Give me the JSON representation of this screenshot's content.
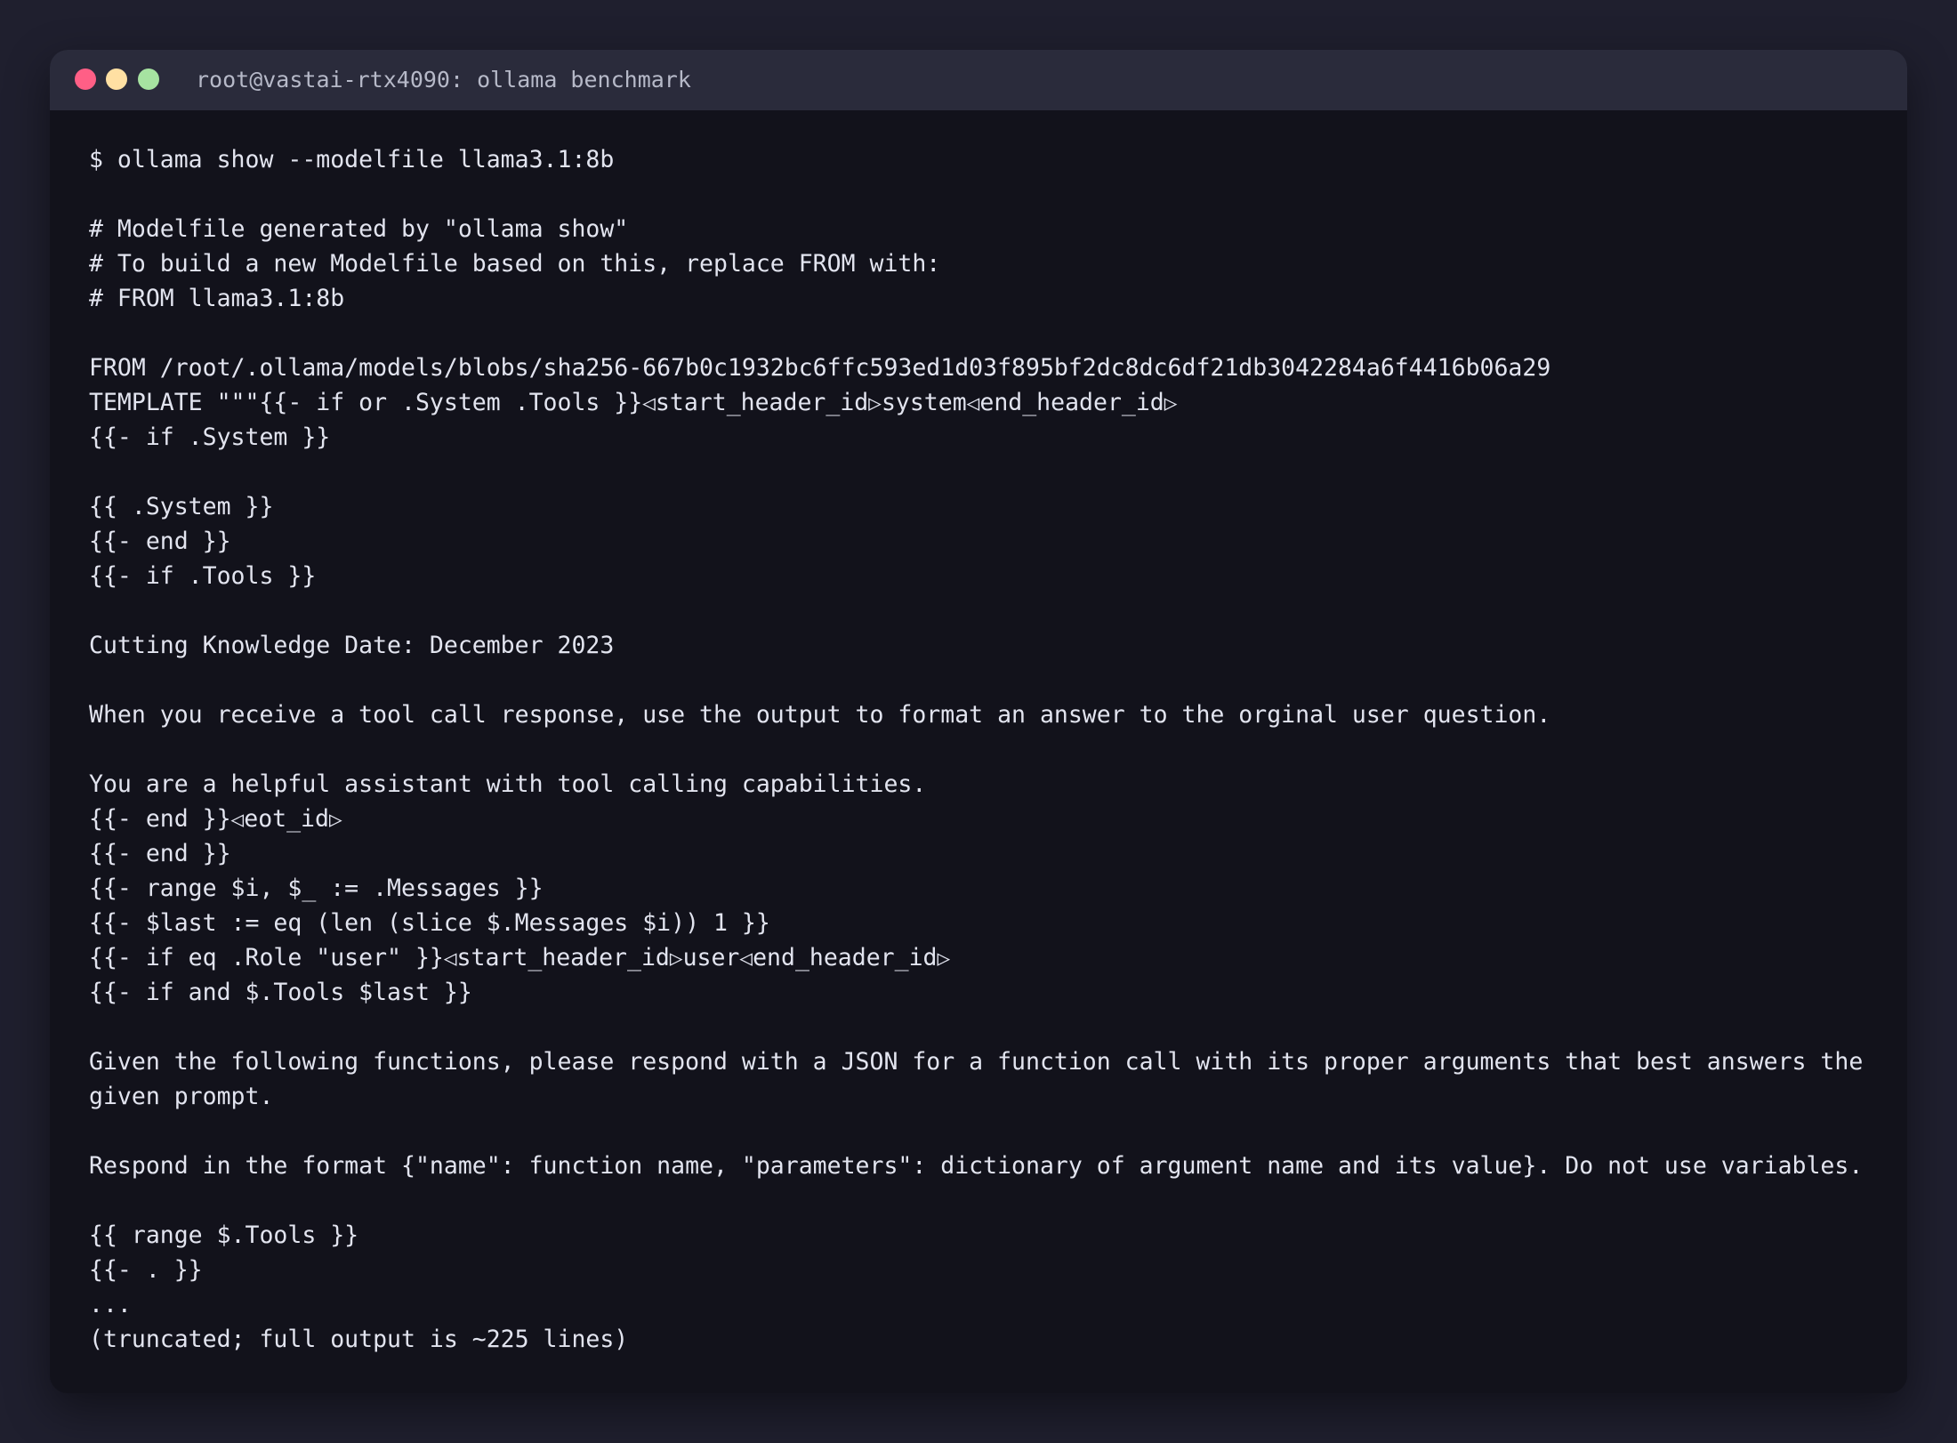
{
  "window": {
    "title": "root@vastai-rtx4090: ollama benchmark",
    "traffic_lights": {
      "close_color": "#ff5f86",
      "minimize_color": "#ffe0a3",
      "maximize_color": "#a6e3a1"
    }
  },
  "terminal": {
    "command_prompt": "$ ollama show --modelfile llama3.1:8b",
    "comment_1": "# Modelfile generated by \"ollama show\"",
    "comment_2": "# To build a new Modelfile based on this, replace FROM with:",
    "comment_3": "# FROM llama3.1:8b",
    "from_line": "FROM /root/.ollama/models/blobs/sha256-667b0c1932bc6ffc593ed1d03f895bf2dc8dc6df21db3042284a6f4416b06a29",
    "template_prefix": "TEMPLATE \"\"\"{{- if or .System .Tools }}",
    "token_left": "◁",
    "token_right": "▷",
    "tok_start_header_id": "start_header_id",
    "tok_end_header_id": "end_header_id",
    "tok_eot_id": "eot_id",
    "word_system": "system",
    "word_user": "user",
    "if_system": "{{- if .System }}",
    "system_var": "{{ .System }}",
    "end_1": "{{- end }}",
    "if_tools": "{{- if .Tools }}",
    "cutting_knowledge": "Cutting Knowledge Date: December 2023",
    "tool_response": "When you receive a tool call response, use the output to format an answer to the orginal user question.",
    "helpful_assistant": "You are a helpful assistant with tool calling capabilities.",
    "end_eot_prefix": "{{- end }}",
    "end_2": "{{- end }}",
    "range_messages": "{{- range $i, $_ := .Messages }}",
    "last_assign": "{{- $last := eq (len (slice $.Messages $i)) 1 }}",
    "if_role_user_prefix": "{{- if eq .Role \"user\" }}",
    "if_and_tools_last": "{{- if and $.Tools $last }}",
    "given_functions_1": "Given the following functions, please respond with a JSON for a function call with its proper arguments that best answers the",
    "given_functions_2": "given prompt.",
    "respond_format": "Respond in the format {\"name\": function name, \"parameters\": dictionary of argument name and its value}. Do not use variables.",
    "range_tools": "{{ range $.Tools }}",
    "dot_line": "{{- . }}",
    "ellipsis": "...",
    "truncated": "(truncated; full output is ~225 lines)"
  }
}
